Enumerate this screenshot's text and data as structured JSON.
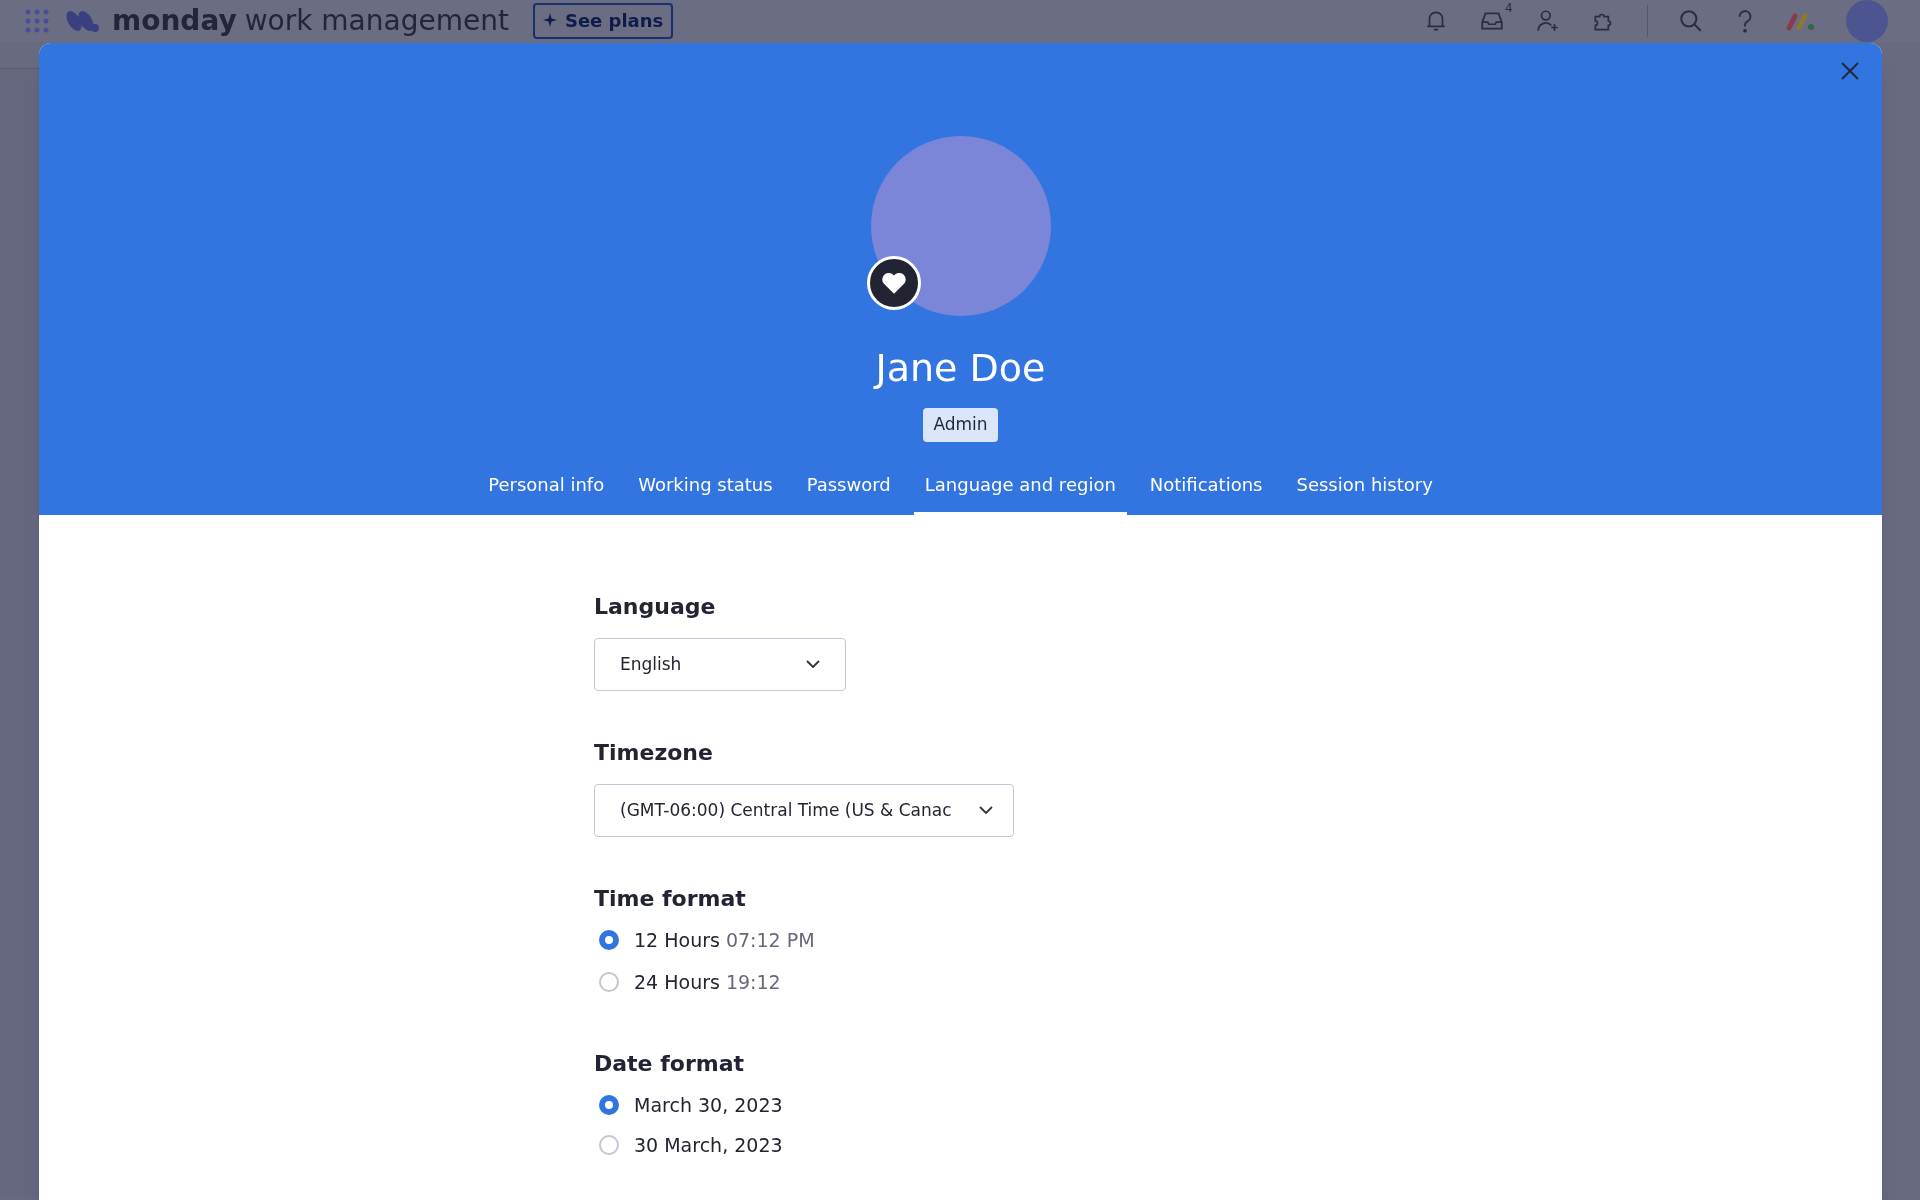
{
  "topbar": {
    "brand": "monday",
    "product": "work management",
    "see_plans": "See plans",
    "inbox_badge": "4"
  },
  "profile": {
    "name": "Jane Doe",
    "role": "Admin"
  },
  "tabs": [
    {
      "label": "Personal info",
      "selected": false
    },
    {
      "label": "Working status",
      "selected": false
    },
    {
      "label": "Password",
      "selected": false
    },
    {
      "label": "Language and region",
      "selected": true
    },
    {
      "label": "Notifications",
      "selected": false
    },
    {
      "label": "Session history",
      "selected": false
    }
  ],
  "language": {
    "label": "Language",
    "value": "English"
  },
  "timezone": {
    "label": "Timezone",
    "value": "(GMT-06:00) Central Time (US & Canac"
  },
  "time_format": {
    "label": "Time format",
    "options": [
      {
        "label": "12 Hours",
        "example": "07:12 PM",
        "selected": true
      },
      {
        "label": "24 Hours",
        "example": "19:12",
        "selected": false
      }
    ]
  },
  "date_format": {
    "label": "Date format",
    "options": [
      {
        "label": "March 30, 2023",
        "selected": true
      },
      {
        "label": "30 March, 2023",
        "selected": false
      }
    ]
  }
}
